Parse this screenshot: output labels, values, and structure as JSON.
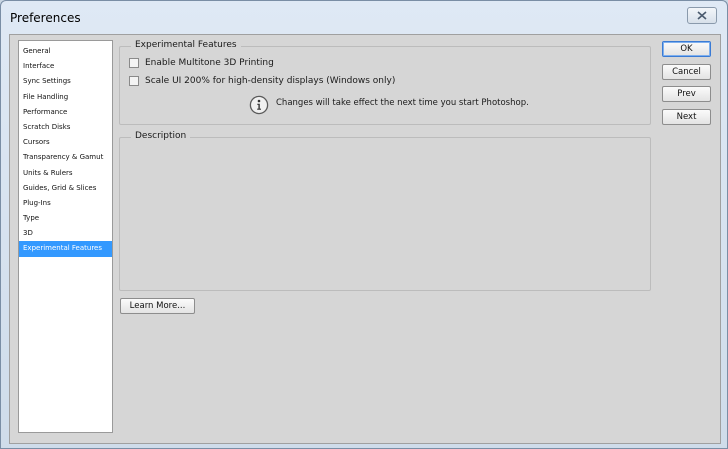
{
  "window": {
    "title": "Preferences"
  },
  "sidebar": {
    "items": [
      {
        "label": "General"
      },
      {
        "label": "Interface"
      },
      {
        "label": "Sync Settings"
      },
      {
        "label": "File Handling"
      },
      {
        "label": "Performance"
      },
      {
        "label": "Scratch Disks"
      },
      {
        "label": "Cursors"
      },
      {
        "label": "Transparency & Gamut"
      },
      {
        "label": "Units & Rulers"
      },
      {
        "label": "Guides, Grid & Slices"
      },
      {
        "label": "Plug-Ins"
      },
      {
        "label": "Type"
      },
      {
        "label": "3D"
      },
      {
        "label": "Experimental Features",
        "selected": true
      }
    ]
  },
  "experimental": {
    "group_label": "Experimental Features",
    "options": [
      {
        "label": "Enable Multitone 3D Printing",
        "checked": false
      },
      {
        "label": "Scale UI 200% for high-density displays (Windows only)",
        "checked": false
      }
    ],
    "info_message": "Changes will take effect the next time you start Photoshop."
  },
  "description": {
    "group_label": "Description"
  },
  "buttons": {
    "ok": "OK",
    "cancel": "Cancel",
    "prev": "Prev",
    "next": "Next",
    "learn_more": "Learn More..."
  },
  "icons": {
    "close": "close-icon",
    "info": "info-icon"
  }
}
